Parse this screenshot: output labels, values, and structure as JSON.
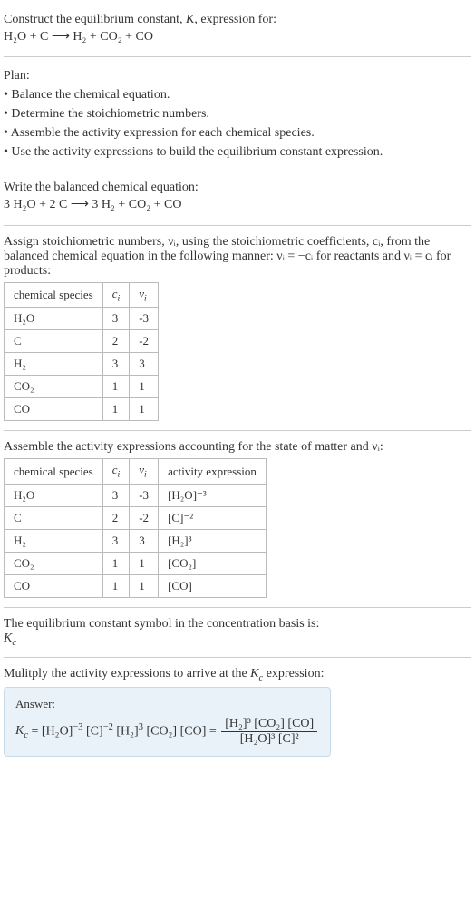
{
  "intro": {
    "line1": "Construct the equilibrium constant, K, expression for:",
    "equation": "H₂O + C ⟶ H₂ + CO₂ + CO"
  },
  "plan": {
    "heading": "Plan:",
    "items": [
      "• Balance the chemical equation.",
      "• Determine the stoichiometric numbers.",
      "• Assemble the activity expression for each chemical species.",
      "• Use the activity expressions to build the equilibrium constant expression."
    ]
  },
  "balanced": {
    "heading": "Write the balanced chemical equation:",
    "equation": "3 H₂O + 2 C ⟶ 3 H₂ + CO₂ + CO"
  },
  "stoich": {
    "text": "Assign stoichiometric numbers, νᵢ, using the stoichiometric coefficients, cᵢ, from the balanced chemical equation in the following manner: νᵢ = −cᵢ for reactants and νᵢ = cᵢ for products:",
    "headers": [
      "chemical species",
      "cᵢ",
      "νᵢ"
    ],
    "rows": [
      [
        "H₂O",
        "3",
        "-3"
      ],
      [
        "C",
        "2",
        "-2"
      ],
      [
        "H₂",
        "3",
        "3"
      ],
      [
        "CO₂",
        "1",
        "1"
      ],
      [
        "CO",
        "1",
        "1"
      ]
    ]
  },
  "activity": {
    "text": "Assemble the activity expressions accounting for the state of matter and νᵢ:",
    "headers": [
      "chemical species",
      "cᵢ",
      "νᵢ",
      "activity expression"
    ],
    "rows": [
      [
        "H₂O",
        "3",
        "-3",
        "[H₂O]⁻³"
      ],
      [
        "C",
        "2",
        "-2",
        "[C]⁻²"
      ],
      [
        "H₂",
        "3",
        "3",
        "[H₂]³"
      ],
      [
        "CO₂",
        "1",
        "1",
        "[CO₂]"
      ],
      [
        "CO",
        "1",
        "1",
        "[CO]"
      ]
    ]
  },
  "symbol": {
    "line1": "The equilibrium constant symbol in the concentration basis is:",
    "line2": "K꜀"
  },
  "multiply": {
    "heading": "Mulitply the activity expressions to arrive at the K꜀ expression:"
  },
  "answer": {
    "label": "Answer:",
    "lhs": "K꜀ = [H₂O]⁻³ [C]⁻² [H₂]³ [CO₂] [CO] = ",
    "numerator": "[H₂]³ [CO₂] [CO]",
    "denominator": "[H₂O]³ [C]²"
  }
}
